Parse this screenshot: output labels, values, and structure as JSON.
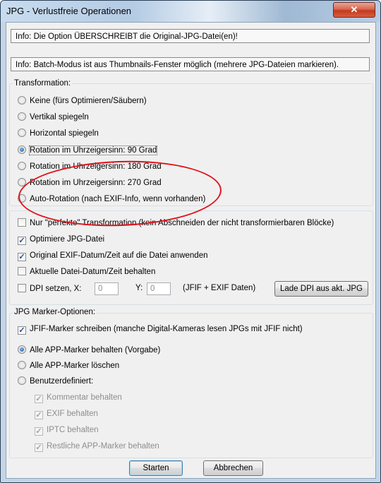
{
  "window": {
    "title": "JPG - Verlustfreie Operationen",
    "close_symbol": "✕"
  },
  "info": {
    "line1": "Info: Die Option ÜBERSCHREIBT die Original-JPG-Datei(en)!",
    "line2": "Info: Batch-Modus ist aus Thumbnails-Fenster möglich (mehrere JPG-Dateien markieren)."
  },
  "transformation": {
    "label": "Transformation:",
    "options": [
      {
        "label": "Keine (fürs Optimieren/Säubern)",
        "selected": false
      },
      {
        "label": "Vertikal spiegeln",
        "selected": false
      },
      {
        "label": "Horizontal spiegeln",
        "selected": false
      },
      {
        "label": "Rotation im Uhrzeigersinn: 90 Grad",
        "selected": true
      },
      {
        "label": "Rotation im Uhrzeigersinn: 180 Grad",
        "selected": false
      },
      {
        "label": "Rotation im Uhrzeigersinn: 270 Grad",
        "selected": false
      },
      {
        "label": "Auto-Rotation (nach EXIF-Info, wenn vorhanden)",
        "selected": false
      }
    ]
  },
  "options": {
    "perfect": {
      "label": "Nur \"perfekte\" Transformation (kein Abschneiden der nicht transformierbaren Blöcke)",
      "checked": false
    },
    "optimize": {
      "label": "Optimiere JPG-Datei",
      "checked": true
    },
    "exif_date": {
      "label": "Original EXIF-Datum/Zeit auf die Datei anwenden",
      "checked": true
    },
    "keep_date": {
      "label": "Aktuelle Datei-Datum/Zeit behalten",
      "checked": false
    },
    "dpi": {
      "label": "DPI setzen, X:",
      "checked": false,
      "x_value": "0",
      "y_label": "Y:",
      "y_value": "0",
      "note": "(JFIF + EXIF Daten)",
      "load_button": "Lade DPI aus akt. JPG"
    }
  },
  "markers": {
    "label": "JPG Marker-Optionen:",
    "jfif": {
      "label": "JFIF-Marker schreiben (manche Digital-Kameras lesen JPGs mit JFIF nicht)",
      "checked": true
    },
    "radio": [
      {
        "label": "Alle APP-Marker behalten (Vorgabe)",
        "selected": true
      },
      {
        "label": "Alle APP-Marker löschen",
        "selected": false
      },
      {
        "label": "Benutzerdefiniert:",
        "selected": false
      }
    ],
    "custom": [
      {
        "label": "Kommentar behalten",
        "checked": true
      },
      {
        "label": "EXIF behalten",
        "checked": true
      },
      {
        "label": "IPTC behalten",
        "checked": true
      },
      {
        "label": "Restliche APP-Marker behalten",
        "checked": true
      }
    ]
  },
  "buttons": {
    "start": "Starten",
    "cancel": "Abbrechen"
  },
  "colors": {
    "annotation_oval": "#e0121a",
    "close_button": "#c23b1e"
  }
}
